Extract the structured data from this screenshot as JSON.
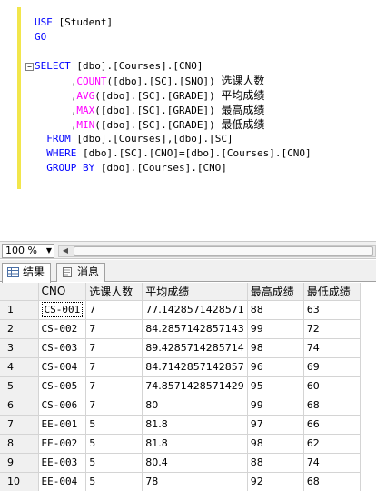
{
  "editor": {
    "code": [
      {
        "parts": [
          {
            "t": "USE",
            "c": "kw"
          },
          {
            "t": " [Student]",
            "c": ""
          }
        ]
      },
      {
        "parts": [
          {
            "t": "GO",
            "c": "kw"
          }
        ]
      },
      {
        "parts": []
      },
      {
        "parts": [
          {
            "t": "SELECT",
            "c": "kw"
          },
          {
            "t": " [dbo].[Courses].[CNO]",
            "c": ""
          }
        ],
        "collapse": true
      },
      {
        "parts": [
          {
            "t": "      ,",
            "c": "gr"
          },
          {
            "t": "COUNT",
            "c": "fn"
          },
          {
            "t": "([dbo].[SC].[SNO]) ",
            "c": ""
          },
          {
            "t": "选课人数",
            "c": "cn"
          }
        ]
      },
      {
        "parts": [
          {
            "t": "      ,",
            "c": "gr"
          },
          {
            "t": "AVG",
            "c": "fn"
          },
          {
            "t": "([dbo].[SC].[GRADE]) ",
            "c": ""
          },
          {
            "t": "平均成绩",
            "c": "cn"
          }
        ]
      },
      {
        "parts": [
          {
            "t": "      ,",
            "c": "gr"
          },
          {
            "t": "MAX",
            "c": "fn"
          },
          {
            "t": "([dbo].[SC].[GRADE]) ",
            "c": ""
          },
          {
            "t": "最高成绩",
            "c": "cn"
          }
        ]
      },
      {
        "parts": [
          {
            "t": "      ,",
            "c": "gr"
          },
          {
            "t": "MIN",
            "c": "fn"
          },
          {
            "t": "([dbo].[SC].[GRADE]) ",
            "c": ""
          },
          {
            "t": "最低成绩",
            "c": "cn"
          }
        ]
      },
      {
        "parts": [
          {
            "t": "  FROM",
            "c": "kw"
          },
          {
            "t": " [dbo].[Courses],[dbo].[SC]",
            "c": ""
          }
        ]
      },
      {
        "parts": [
          {
            "t": "  WHERE",
            "c": "kw"
          },
          {
            "t": " [dbo].[SC].[CNO]=[dbo].[Courses].[CNO]",
            "c": ""
          }
        ]
      },
      {
        "parts": [
          {
            "t": "  GROUP BY",
            "c": "kw"
          },
          {
            "t": " [dbo].[Courses].[CNO]",
            "c": ""
          }
        ]
      }
    ],
    "collapse_glyph": "−"
  },
  "zoom": {
    "value": "100 %",
    "arrow": "▼"
  },
  "hscroll": {
    "left_arrow": "◀"
  },
  "tabs": {
    "results": "结果",
    "messages": "消息"
  },
  "grid": {
    "headers": [
      "",
      "CNO",
      "选课人数",
      "平均成绩",
      "最高成绩",
      "最低成绩"
    ],
    "rows": [
      [
        "1",
        "CS-001",
        "7",
        "77.1428571428571",
        "88",
        "63"
      ],
      [
        "2",
        "CS-002",
        "7",
        "84.2857142857143",
        "99",
        "72"
      ],
      [
        "3",
        "CS-003",
        "7",
        "89.4285714285714",
        "98",
        "74"
      ],
      [
        "4",
        "CS-004",
        "7",
        "84.7142857142857",
        "96",
        "69"
      ],
      [
        "5",
        "CS-005",
        "7",
        "74.8571428571429",
        "95",
        "60"
      ],
      [
        "6",
        "CS-006",
        "7",
        "80",
        "99",
        "68"
      ],
      [
        "7",
        "EE-001",
        "5",
        "81.8",
        "97",
        "66"
      ],
      [
        "8",
        "EE-002",
        "5",
        "81.8",
        "98",
        "62"
      ],
      [
        "9",
        "EE-003",
        "5",
        "80.4",
        "88",
        "74"
      ],
      [
        "10",
        "EE-004",
        "5",
        "78",
        "92",
        "68"
      ]
    ]
  },
  "colors": {
    "keyword": "#0000ff",
    "function": "#ff00ff",
    "margin": "#f2e64b"
  }
}
